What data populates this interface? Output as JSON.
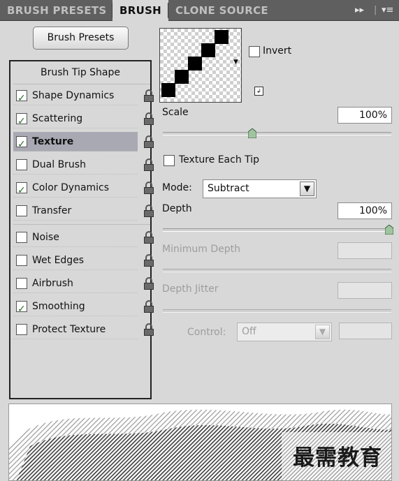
{
  "tabs": [
    {
      "label": "BRUSH PRESETS",
      "active": false
    },
    {
      "label": "BRUSH",
      "active": true
    },
    {
      "label": "CLONE SOURCE",
      "active": false
    }
  ],
  "tabbar_icons": {
    "collapse": "▸▸",
    "menu": "▾≡"
  },
  "presets_button": "Brush Presets",
  "tip_shape_header": "Brush Tip Shape",
  "options": [
    {
      "label": "Shape Dynamics",
      "checked": true
    },
    {
      "label": "Scattering",
      "checked": true
    },
    {
      "label": "Texture",
      "checked": true,
      "selected": true
    },
    {
      "label": "Dual Brush",
      "checked": false
    },
    {
      "label": "Color Dynamics",
      "checked": true
    },
    {
      "label": "Transfer",
      "checked": false
    },
    {
      "label": "Noise",
      "checked": false
    },
    {
      "label": "Wet Edges",
      "checked": false
    },
    {
      "label": "Airbrush",
      "checked": false
    },
    {
      "label": "Smoothing",
      "checked": true
    },
    {
      "label": "Protect Texture",
      "checked": false
    }
  ],
  "texture": {
    "invert_label": "Invert",
    "scale_label": "Scale",
    "scale_value": "100%",
    "scale_fraction": 0.39,
    "texture_each_tip_label": "Texture Each Tip",
    "mode_label": "Mode:",
    "mode_value": "Subtract",
    "depth_label": "Depth",
    "depth_value": "100%",
    "depth_fraction": 1.0,
    "min_depth_label": "Minimum Depth",
    "depth_jitter_label": "Depth Jitter",
    "control_label": "Control:",
    "control_value": "Off"
  },
  "watermark": "最需教育",
  "colors": {
    "selected_row": "#a9a9b3",
    "tab_bar": "#5f5f5f",
    "panel": "#d8d8d8"
  }
}
